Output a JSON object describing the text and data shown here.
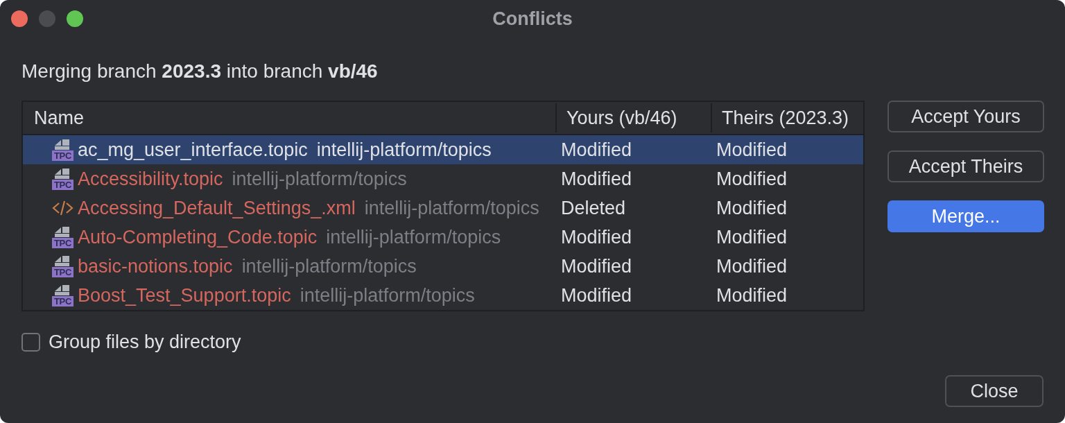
{
  "window": {
    "title": "Conflicts",
    "controls": [
      {
        "kind": "close",
        "disabled": false
      },
      {
        "kind": "minimize",
        "disabled": true
      },
      {
        "kind": "zoom",
        "disabled": false
      }
    ]
  },
  "message": "Merging branch **2023.3** into branch **vb/46**",
  "table": {
    "columns": [
      "Name",
      "Yours (vb/46)",
      "Theirs (2023.3)"
    ],
    "rows": [
      {
        "kind": "topic",
        "icon_text": "TPC",
        "name": "ac_mg_user_interface.topic",
        "path": "intellij-platform/topics",
        "yours": "Modified",
        "theirs": "Modified",
        "selected": true
      },
      {
        "kind": "topic",
        "icon_text": "TPC",
        "name": "Accessibility.topic",
        "path": "intellij-platform/topics",
        "yours": "Modified",
        "theirs": "Modified",
        "selected": false
      },
      {
        "kind": "xml",
        "name": "Accessing_Default_Settings_.xml",
        "path": "intellij-platform/topics",
        "yours": "Deleted",
        "theirs": "Modified",
        "selected": false
      },
      {
        "kind": "topic",
        "icon_text": "TPC",
        "name": "Auto-Completing_Code.topic",
        "path": "intellij-platform/topics",
        "yours": "Modified",
        "theirs": "Modified",
        "selected": false
      },
      {
        "kind": "topic",
        "icon_text": "TPC",
        "name": "basic-notions.topic",
        "path": "intellij-platform/topics",
        "yours": "Modified",
        "theirs": "Modified",
        "selected": false
      },
      {
        "kind": "topic",
        "icon_text": "TPC",
        "name": "Boost_Test_Support.topic",
        "path": "intellij-platform/topics",
        "yours": "Modified",
        "theirs": "Modified",
        "selected": false
      }
    ]
  },
  "buttons": [
    {
      "label": "Accept Yours",
      "default": false
    },
    {
      "label": "Accept Theirs",
      "default": false
    },
    {
      "label": "Merge...",
      "default": true
    }
  ],
  "group_by_directory": {
    "label": "Group files by directory",
    "checked": false
  },
  "close_button": {
    "label": "Close"
  }
}
